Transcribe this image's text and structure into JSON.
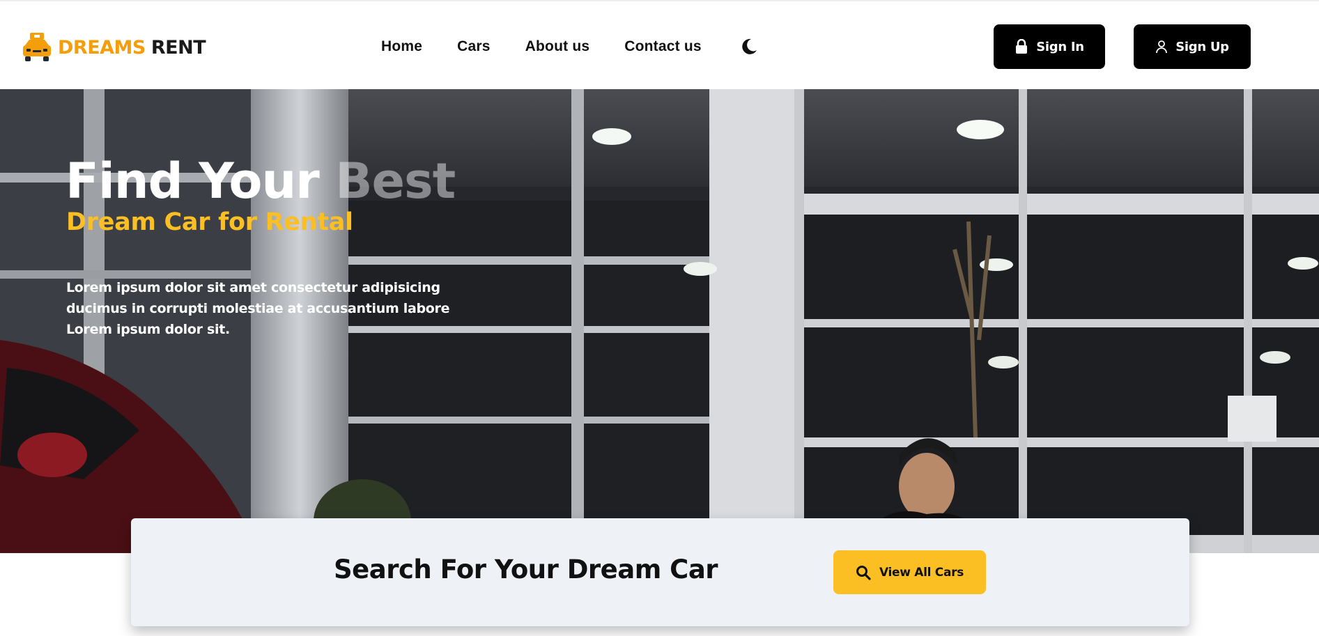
{
  "brand": {
    "name_accent": "DREAMS",
    "name_dark": "RENT",
    "accent_color": "#f59e0b"
  },
  "nav": {
    "items": [
      "Home",
      "Cars",
      "About us",
      "Contact us"
    ],
    "theme_icon": "moon-icon"
  },
  "auth": {
    "signin_label": "Sign In",
    "signup_label": "Sign Up"
  },
  "hero": {
    "title_main": "Find Your ",
    "title_fade": "Best",
    "subtitle": "Dream Car for Rental",
    "description_lines": [
      "Lorem ipsum dolor sit amet consectetur adipisicing",
      "ducimus in corrupti molestiae at accusantium labore",
      "Lorem ipsum dolor sit."
    ],
    "subtitle_color": "#fbbf24"
  },
  "search": {
    "title": "Search For Your Dream Car",
    "button_label": "View All Cars",
    "button_icon": "search-icon"
  }
}
